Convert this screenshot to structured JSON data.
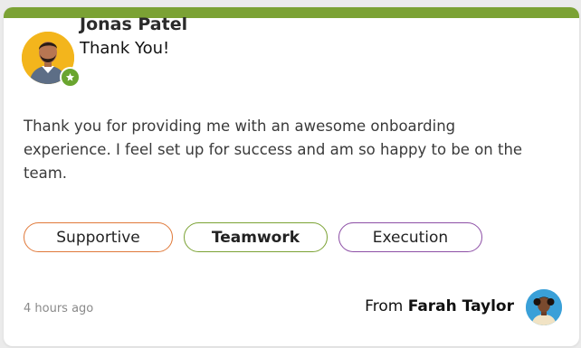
{
  "card": {
    "accent_color": "#7ba234",
    "recipient": {
      "name": "Jonas Patel",
      "avatar_icon": "person-avatar-icon",
      "badge_icon": "star-icon",
      "badge_color": "#6aa52f"
    },
    "title": "Thank You!",
    "message": "Thank you for providing me with an awesome onboarding experience. I feel set up for success and am so happy to be on the team.",
    "tags": [
      {
        "label": "Supportive",
        "color": "#e0793a"
      },
      {
        "label": "Teamwork",
        "color": "#7ba234"
      },
      {
        "label": "Execution",
        "color": "#8d4fa6"
      }
    ],
    "timestamp": "4 hours ago",
    "from": {
      "prefix": "From",
      "name": "Farah Taylor",
      "avatar_icon": "person-avatar-icon"
    }
  }
}
